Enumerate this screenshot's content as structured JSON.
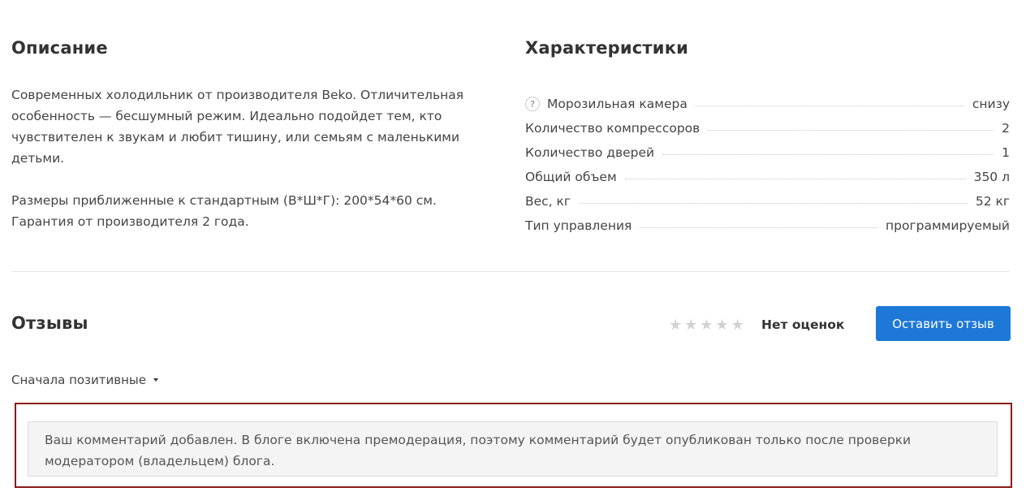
{
  "description": {
    "title": "Описание",
    "paragraphs": [
      "Современных холодильник от производителя Beko. Отличительная особенность — бесшумный режим. Идеально подойдет тем, кто чувствителен к звукам и любит тишину, или семьям с маленькими детьми.",
      "Размеры приближенные к стандартным (В*Ш*Г): 200*54*60 см. Гарантия от производителя 2 года."
    ]
  },
  "specs": {
    "title": "Характеристики",
    "help_icon_label": "?",
    "rows": [
      {
        "name": "Морозильная камера",
        "value": "снизу",
        "has_help": true
      },
      {
        "name": "Количество компрессоров",
        "value": "2",
        "has_help": false
      },
      {
        "name": "Количество дверей",
        "value": "1",
        "has_help": false
      },
      {
        "name": "Общий объем",
        "value": "350 л",
        "has_help": false
      },
      {
        "name": "Вес, кг",
        "value": "52 кг",
        "has_help": false
      },
      {
        "name": "Тип управления",
        "value": "программируемый",
        "has_help": false
      }
    ]
  },
  "reviews": {
    "title": "Отзывы",
    "rating": 0,
    "rating_max": 5,
    "star_glyph": "★",
    "no_rating_label": "Нет оценок",
    "leave_review_label": "Оставить отзыв",
    "sort_label": "Сначала позитивные",
    "notice": "Ваш комментарий добавлен. В блоге включена премодерация, поэтому комментарий будет опубликован только после проверки модератором (владельцем) блога."
  },
  "colors": {
    "accent": "#1e78d7",
    "notice_border": "#8b1a1a",
    "star_empty": "#d2d2d2"
  }
}
